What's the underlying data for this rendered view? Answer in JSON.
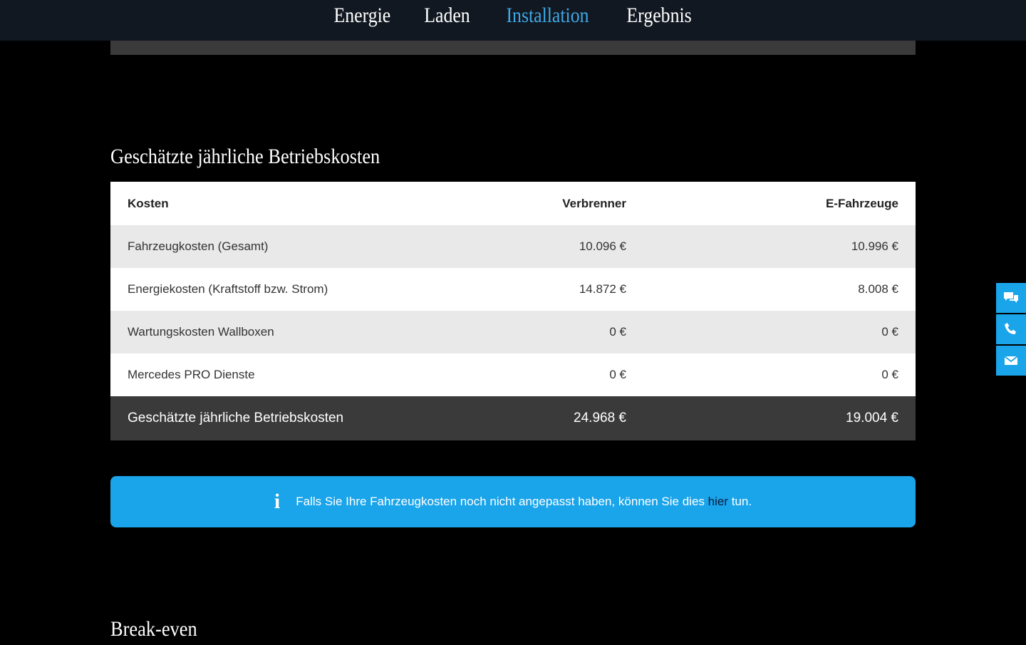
{
  "nav": {
    "tabs": [
      {
        "label": "Energie"
      },
      {
        "label": "Laden"
      },
      {
        "label": "Installation"
      },
      {
        "label": "Ergebnis"
      }
    ],
    "active_index": 2
  },
  "costs": {
    "title": "Geschätzte jährliche Betriebskosten",
    "headers": {
      "kosten": "Kosten",
      "verbrenner": "Verbrenner",
      "efahrzeuge": "E-Fahrzeuge"
    },
    "rows": [
      {
        "label": "Fahrzeugkosten (Gesamt)",
        "verbrenner": "10.096 €",
        "efahrzeuge": "10.996 €"
      },
      {
        "label": "Energiekosten (Kraftstoff bzw. Strom)",
        "verbrenner": "14.872 €",
        "efahrzeuge": "8.008 €"
      },
      {
        "label": "Wartungskosten Wallboxen",
        "verbrenner": "0 €",
        "efahrzeuge": "0 €"
      },
      {
        "label": "Mercedes PRO Dienste",
        "verbrenner": "0 €",
        "efahrzeuge": "0 €"
      }
    ],
    "total": {
      "label": "Geschätzte jährliche Betriebskosten",
      "verbrenner": "24.968 €",
      "efahrzeuge": "19.004 €"
    }
  },
  "info": {
    "icon": "info-icon",
    "icon_glyph": "i",
    "text_before": "Falls Sie Ihre Fahrzeugkosten noch nicht angepasst haben, können Sie dies ",
    "link_text": "hier",
    "text_after": " tun."
  },
  "breakeven": {
    "title": "Break-even"
  },
  "side_buttons": [
    {
      "icon": "chat-icon"
    },
    {
      "icon": "phone-icon"
    },
    {
      "icon": "mail-icon"
    }
  ],
  "colors": {
    "accent": "#1aa4ea",
    "active_tab": "#3ea8e6",
    "nav_bg": "#111821",
    "total_row_bg": "#3a3a3a"
  }
}
